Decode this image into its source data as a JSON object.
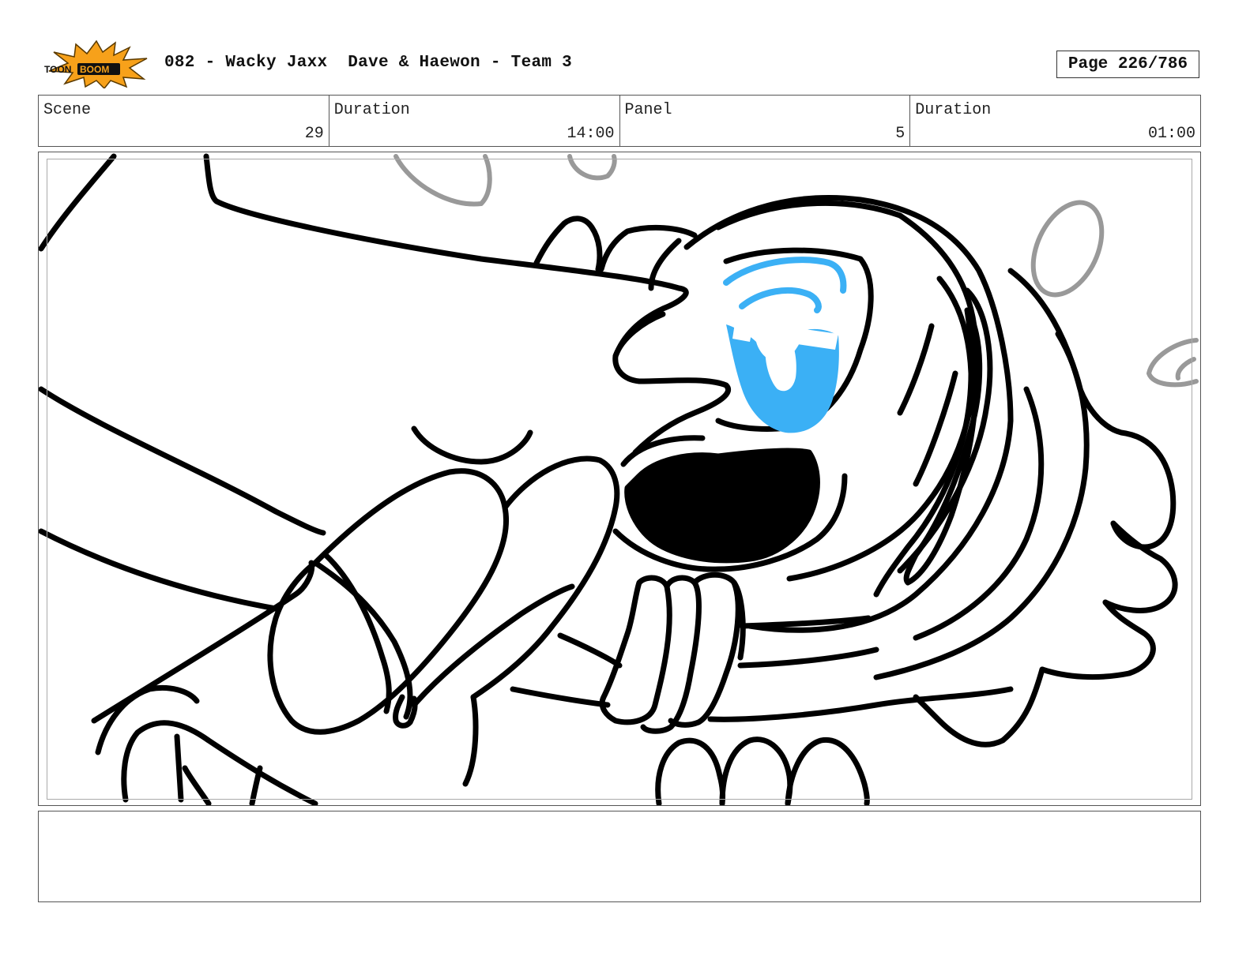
{
  "header": {
    "logo_text": "TOONBOOM",
    "title": "082 - Wacky Jaxx  Dave & Haewon - Team 3",
    "page_label": "Page 226/786"
  },
  "info": {
    "scene_label": "Scene",
    "scene_value": "29",
    "duration_label": "Duration",
    "duration_value": "14:00",
    "panel_label": "Panel",
    "panel_value": "5",
    "panel_duration_label": "Duration",
    "panel_duration_value": "01:00"
  },
  "panel": {
    "description": "",
    "colors": {
      "ink": "#000000",
      "eye": "#3BB0F5",
      "bubble": "#999999"
    }
  },
  "notes": {
    "text": ""
  }
}
